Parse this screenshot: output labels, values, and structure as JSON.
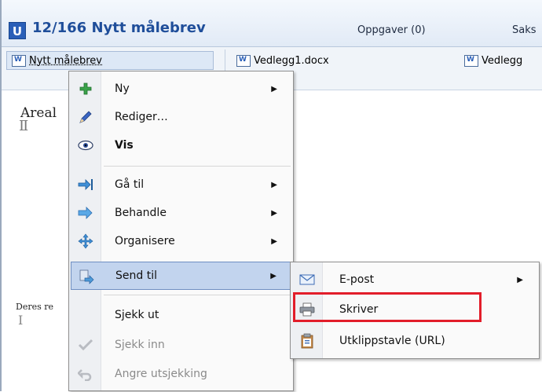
{
  "header": {
    "badge": "U",
    "title": "12/166  Nytt målebrev",
    "tab_tasks": "Oppgaver (0)",
    "tab_case": "Saks"
  },
  "doc_tabs": [
    {
      "label": "Nytt målebrev"
    },
    {
      "label": "Vedlegg1.docx"
    },
    {
      "label": "Vedlegg"
    }
  ],
  "document": {
    "line1": "Areal",
    "line2": "Deres re"
  },
  "context_menu": {
    "items": [
      {
        "label": "Ny",
        "icon": "plus-icon",
        "submenu": true
      },
      {
        "label": "Rediger…",
        "icon": "pencil-icon"
      },
      {
        "label": "Vis",
        "icon": "eye-icon",
        "bold": true
      },
      {
        "label": "Gå til",
        "icon": "goto-arrow-icon",
        "submenu": true
      },
      {
        "label": "Behandle",
        "icon": "process-icon",
        "submenu": true
      },
      {
        "label": "Organisere",
        "icon": "move-cross-icon",
        "submenu": true
      },
      {
        "label": "Send til",
        "icon": "send-to-icon",
        "submenu": true,
        "active": true
      },
      {
        "label": "Sjekk ut",
        "icon": ""
      },
      {
        "label": "Sjekk inn",
        "icon": "checkmark-icon",
        "disabled": true
      },
      {
        "label": "Angre utsjekking",
        "icon": "undo-icon",
        "disabled": true
      }
    ]
  },
  "send_to_menu": {
    "items": [
      {
        "label": "E-post",
        "icon": "envelope-icon",
        "submenu": true
      },
      {
        "label": "Skriver",
        "icon": "printer-icon",
        "highlighted": true
      },
      {
        "label": "Utklippstavle (URL)",
        "icon": "clipboard-icon"
      }
    ]
  },
  "colors": {
    "title": "#1f4e9a",
    "badge": "#2a5fb8",
    "menu_hover": "#c2d4ee",
    "highlight_box": "#e21d2a"
  }
}
